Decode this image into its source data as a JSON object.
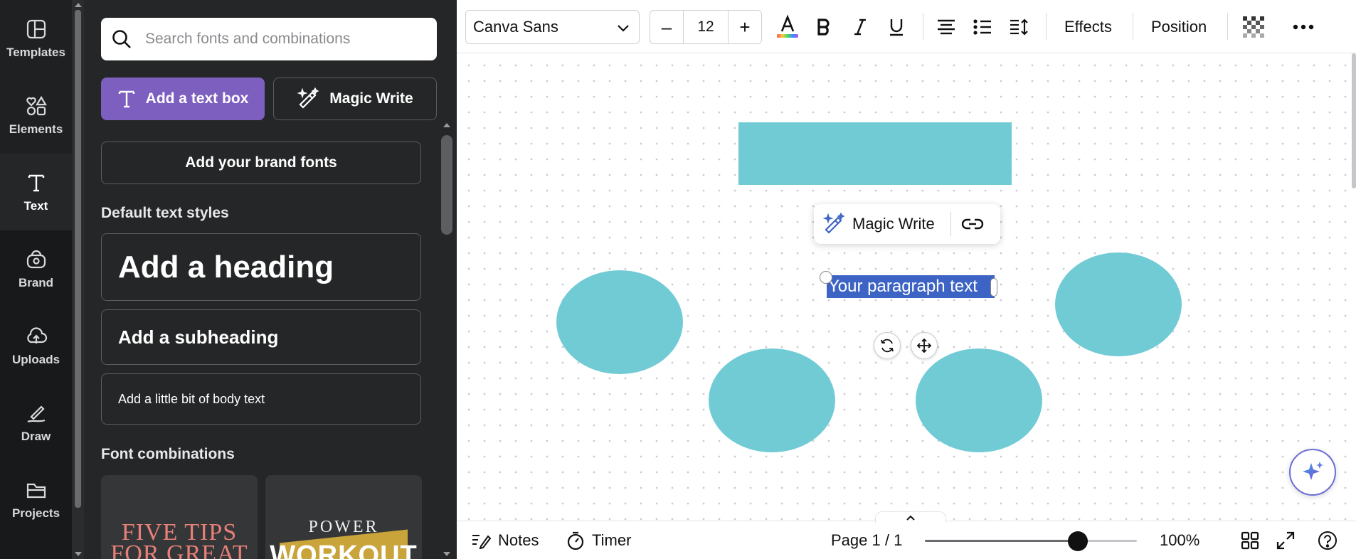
{
  "rail": {
    "items": [
      {
        "label": "Templates",
        "icon": "templates-icon"
      },
      {
        "label": "Elements",
        "icon": "elements-icon"
      },
      {
        "label": "Text",
        "icon": "text-icon"
      },
      {
        "label": "Brand",
        "icon": "brand-icon"
      },
      {
        "label": "Uploads",
        "icon": "uploads-icon"
      },
      {
        "label": "Draw",
        "icon": "draw-icon"
      },
      {
        "label": "Projects",
        "icon": "projects-icon"
      }
    ],
    "active": "Text"
  },
  "panel": {
    "search_placeholder": "Search fonts and combinations",
    "add_textbox_label": "Add a text box",
    "magic_write_label": "Magic Write",
    "brand_fonts_label": "Add your brand fonts",
    "default_styles_title": "Default text styles",
    "heading_label": "Add a heading",
    "subheading_label": "Add a subheading",
    "body_label": "Add a little bit of body text",
    "combinations_title": "Font combinations",
    "combo_1": {
      "line1": "FIVE TIPS",
      "line2": "FOR GREAT"
    },
    "combo_2": {
      "line1": "POWER",
      "line2": "WORKOUT"
    }
  },
  "toolbar": {
    "font_name": "Canva Sans",
    "font_size": "12",
    "decrease_label": "–",
    "increase_label": "+",
    "effects_label": "Effects",
    "position_label": "Position"
  },
  "canvas": {
    "floating_magic_write": "Magic Write",
    "selected_text": "Your paragraph text",
    "shape_color": "#71cbd5",
    "selection_color": "#3d64c4"
  },
  "bottombar": {
    "notes_label": "Notes",
    "timer_label": "Timer",
    "page_indicator": "Page 1 / 1",
    "zoom_percent": "100%",
    "zoom_fraction": 0.72
  },
  "colors": {
    "accent_purple": "#7d5fc0",
    "sidebar_bg": "#18191b",
    "panel_bg": "#252627"
  }
}
